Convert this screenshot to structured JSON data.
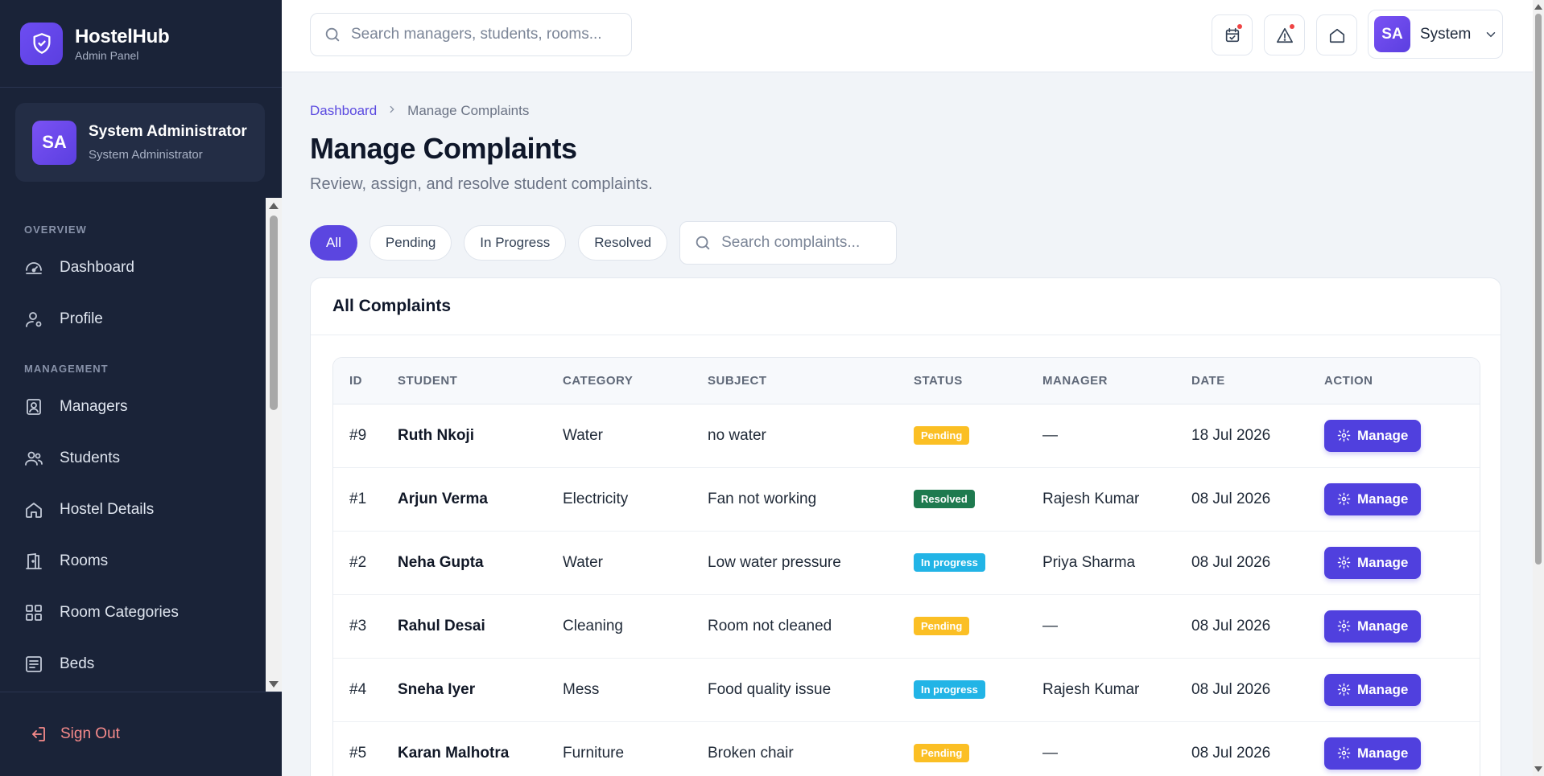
{
  "brand": {
    "name": "HostelHub",
    "sub": "Admin Panel"
  },
  "user": {
    "initials": "SA",
    "name": "System Administrator",
    "role": "System Administrator"
  },
  "nav": {
    "overview_label": "OVERVIEW",
    "management_label": "MANAGEMENT",
    "items": [
      {
        "label": "Dashboard",
        "icon": "dashboard-icon"
      },
      {
        "label": "Profile",
        "icon": "profile-icon"
      },
      {
        "label": "Managers",
        "icon": "managers-icon"
      },
      {
        "label": "Students",
        "icon": "students-icon"
      },
      {
        "label": "Hostel Details",
        "icon": "home-icon"
      },
      {
        "label": "Rooms",
        "icon": "door-icon"
      },
      {
        "label": "Room Categories",
        "icon": "grid-icon"
      },
      {
        "label": "Beds",
        "icon": "beds-icon"
      }
    ],
    "sign_out": "Sign Out"
  },
  "topbar": {
    "search_placeholder": "Search managers, students, rooms...",
    "profile_initials": "SA",
    "profile_name": "System"
  },
  "page": {
    "breadcrumb_home": "Dashboard",
    "breadcrumb_current": "Manage Complaints",
    "title": "Manage Complaints",
    "subtitle": "Review, assign, and resolve student complaints."
  },
  "filters": {
    "chips": [
      "All",
      "Pending",
      "In Progress",
      "Resolved"
    ],
    "search_placeholder": "Search complaints..."
  },
  "table": {
    "title": "All Complaints",
    "columns": [
      "ID",
      "STUDENT",
      "CATEGORY",
      "SUBJECT",
      "STATUS",
      "MANAGER",
      "DATE",
      "ACTION"
    ],
    "action_label": "Manage",
    "rows": [
      {
        "id": "#9",
        "student": "Ruth Nkoji",
        "category": "Water",
        "subject": "no water",
        "status": "Pending",
        "manager": "—",
        "date": "18 Jul 2026"
      },
      {
        "id": "#1",
        "student": "Arjun Verma",
        "category": "Electricity",
        "subject": "Fan not working",
        "status": "Resolved",
        "manager": "Rajesh Kumar",
        "date": "08 Jul 2026"
      },
      {
        "id": "#2",
        "student": "Neha Gupta",
        "category": "Water",
        "subject": "Low water pressure",
        "status": "In progress",
        "manager": "Priya Sharma",
        "date": "08 Jul 2026"
      },
      {
        "id": "#3",
        "student": "Rahul Desai",
        "category": "Cleaning",
        "subject": "Room not cleaned",
        "status": "Pending",
        "manager": "—",
        "date": "08 Jul 2026"
      },
      {
        "id": "#4",
        "student": "Sneha Iyer",
        "category": "Mess",
        "subject": "Food quality issue",
        "status": "In progress",
        "manager": "Rajesh Kumar",
        "date": "08 Jul 2026"
      },
      {
        "id": "#5",
        "student": "Karan Malhotra",
        "category": "Furniture",
        "subject": "Broken chair",
        "status": "Pending",
        "manager": "—",
        "date": "08 Jul 2026"
      }
    ]
  },
  "colors": {
    "accent": "#5b46e0",
    "sidebar": "#1a2338",
    "pending": "#fbbf24",
    "resolved": "#1e7a4f",
    "in_progress": "#22b4e6"
  }
}
